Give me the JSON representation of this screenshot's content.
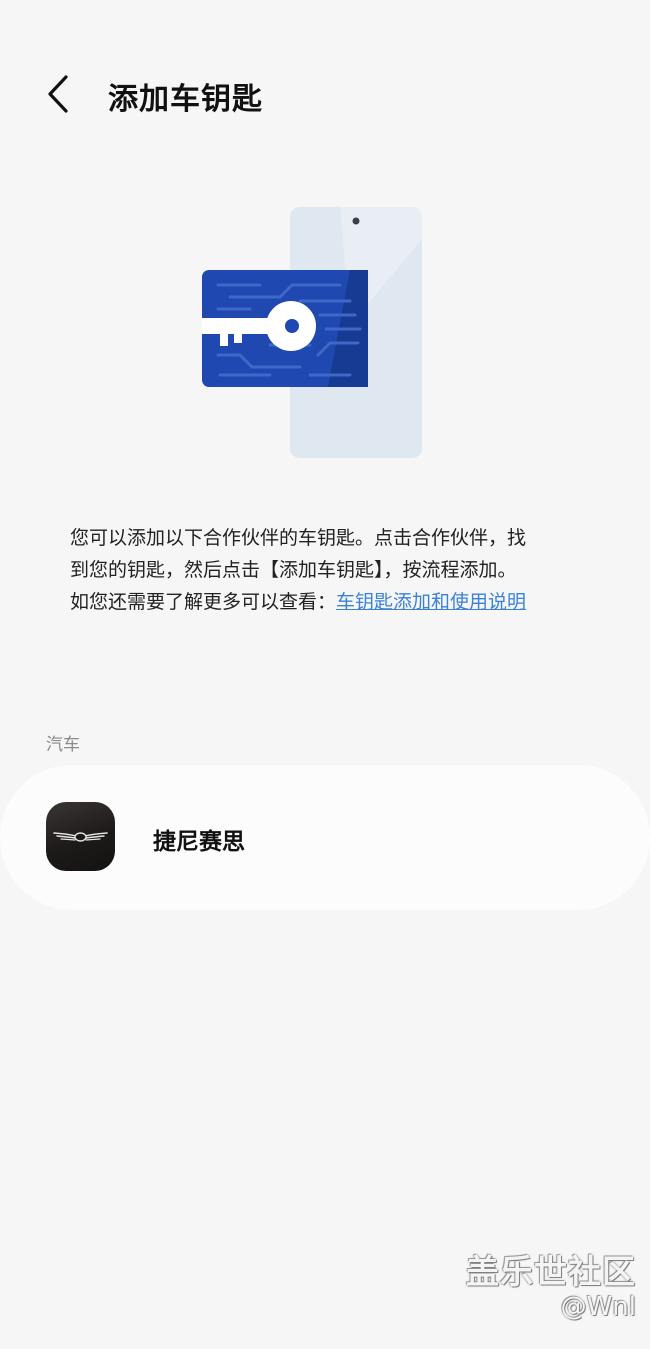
{
  "header": {
    "title": "添加车钥匙",
    "back_icon": "chevron-left-icon"
  },
  "illustration": {
    "name": "car-key-card-on-phone",
    "card_color": "#1f48b0",
    "phone_color": "#dde6f1"
  },
  "description": {
    "line1": "您可以添加以下合作伙伴的车钥匙。点击合作伙伴，找",
    "line2": "到您的钥匙，然后点击【添加车钥匙】，按流程添加。",
    "line3_prefix": "如您还需要了解更多可以查看：",
    "link_text": "车钥匙添加和使用说明",
    "link_color": "#3b82d6"
  },
  "section": {
    "label": "汽车"
  },
  "partners": [
    {
      "name": "捷尼赛思",
      "logo_icon": "genesis-wings-logo-icon"
    }
  ],
  "watermark": {
    "title": "盖乐世社区",
    "handle": "@Wnl"
  }
}
